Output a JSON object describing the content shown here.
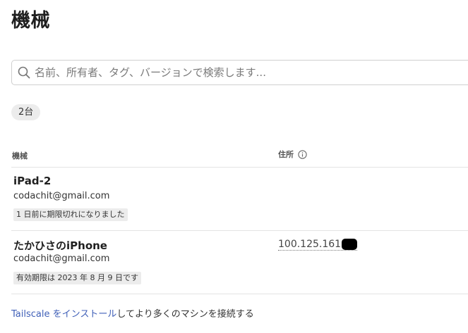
{
  "page": {
    "title": "機械"
  },
  "search": {
    "placeholder": "名前、所有者、タグ、バージョンで検索します...",
    "value": "",
    "icon": "search-icon"
  },
  "summary": {
    "count_label": "2台"
  },
  "table": {
    "headers": {
      "machine": "機械",
      "address": "住所",
      "address_icon": "info-icon"
    },
    "rows": [
      {
        "name": "iPad-2",
        "email": "codachit@gmail.com",
        "status": "1 日前に期限切れになりました",
        "address": ""
      },
      {
        "name": "たかひさのiPhone",
        "email": "codachit@gmail.com",
        "status": "有効期限は 2023 年 8 月 9 日です",
        "address": "100.125.161"
      }
    ]
  },
  "footer": {
    "link_text": "Tailscale をインストール",
    "rest_text": "してより多くのマシンを接続する"
  },
  "colors": {
    "link": "#4060b8",
    "badge_background": "#ececec",
    "redaction": "#000000"
  }
}
